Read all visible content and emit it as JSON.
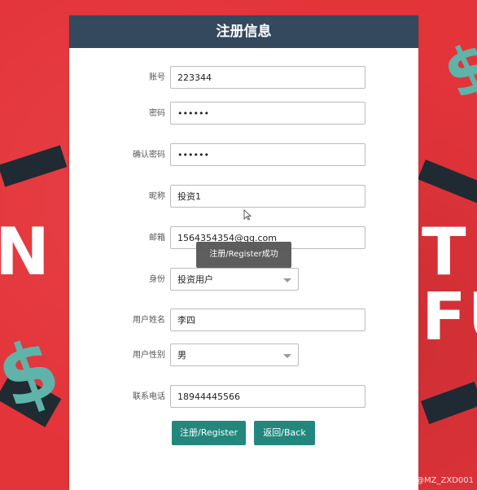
{
  "form": {
    "title": "注册信息",
    "fields": {
      "account": {
        "label": "账号",
        "value": "223344"
      },
      "password": {
        "label": "密码",
        "value": "••••••"
      },
      "confirm_password": {
        "label": "确认密码",
        "value": "••••••"
      },
      "nickname": {
        "label": "昵称",
        "value": "投资1"
      },
      "email": {
        "label": "邮箱",
        "value": "1564354354@qq.com"
      },
      "identity": {
        "label": "身份",
        "value": "投资用户"
      },
      "real_name": {
        "label": "用户姓名",
        "value": "李四"
      },
      "gender": {
        "label": "用户性别",
        "value": "男"
      },
      "phone": {
        "label": "联系电话",
        "value": "18944445566"
      }
    },
    "buttons": {
      "register": "注册/Register",
      "back": "返回/Back"
    }
  },
  "toast": "注册/Register成功",
  "background": {
    "left_text": "N ID",
    "right_text": "T FU",
    "dollar": "$"
  },
  "watermark": "CSDN @MZ_ZXD001",
  "colors": {
    "background": "#e3343a",
    "header": "#34495e",
    "button": "#23877e"
  }
}
